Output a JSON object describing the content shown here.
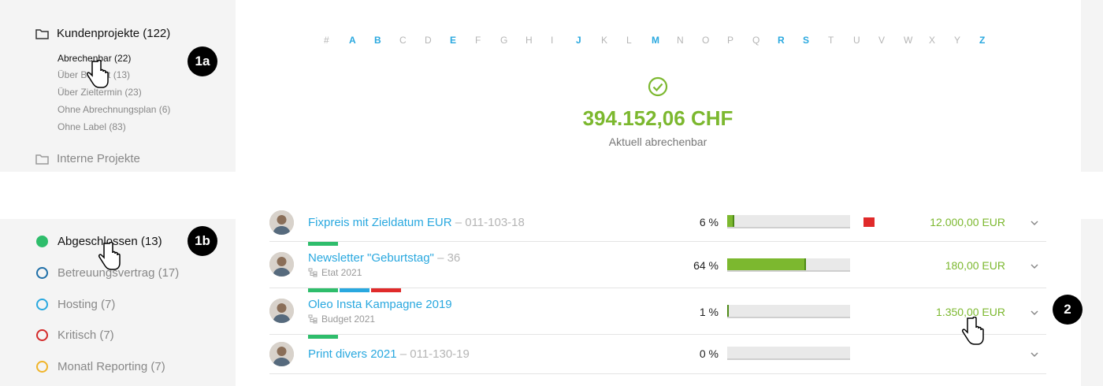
{
  "sidebar_top": {
    "main_folder": "Kundenprojekte (122)",
    "sub_items": [
      "Abrechenbar (22)",
      "Über Budget (13)",
      "Über Zieltermin (23)",
      "Ohne Abrechnungsplan (6)",
      "Ohne Label (83)"
    ],
    "internal_folder": "Interne Projekte",
    "badge": "1a"
  },
  "alphabet": {
    "letters": [
      "#",
      "A",
      "B",
      "C",
      "D",
      "E",
      "F",
      "G",
      "H",
      "I",
      "J",
      "K",
      "L",
      "M",
      "N",
      "O",
      "P",
      "Q",
      "R",
      "S",
      "T",
      "U",
      "V",
      "W",
      "X",
      "Y",
      "Z"
    ],
    "active": [
      "A",
      "B",
      "E",
      "J",
      "M",
      "R",
      "S",
      "Z"
    ]
  },
  "summary": {
    "amount": "394.152,06 CHF",
    "label": "Aktuell abrechenbar",
    "accent": "#7cb82f"
  },
  "status_filters": {
    "badge": "1b",
    "items": [
      {
        "label": "Abgeschlossen (13)",
        "color": "#2ebd6b",
        "filled": true
      },
      {
        "label": "Betreuungsvertrag (17)",
        "color": "#1f6fa8",
        "filled": false
      },
      {
        "label": "Hosting (7)",
        "color": "#29a8df",
        "filled": false
      },
      {
        "label": "Kritisch (7)",
        "color": "#d42a2a",
        "filled": false
      },
      {
        "label": "Monatl Reporting (7)",
        "color": "#f0b429",
        "filled": false
      }
    ]
  },
  "projects": [
    {
      "title": "Fixpreis mit Zieldatum EUR",
      "code": "– 011-103-18",
      "percent": "6 %",
      "progress": 0.06,
      "amount": "12.000,00 EUR",
      "sub": ""
    },
    {
      "title": "Newsletter \"Geburtstag\"",
      "code": "– 36",
      "percent": "64 %",
      "progress": 0.64,
      "amount": "180,00 EUR",
      "sub": "Etat 2021"
    },
    {
      "title": "Oleo Insta Kampagne 2019",
      "code": "",
      "percent": "1 %",
      "progress": 0.01,
      "amount": "1.350,00 EUR",
      "sub": "Budget 2021"
    },
    {
      "title": "Print divers 2021",
      "code": "– 011-130-19",
      "percent": "0 %",
      "progress": 0.0,
      "amount": "",
      "sub": ""
    }
  ],
  "row_badge": "2",
  "icons": [
    "folder-icon",
    "check-circle-icon",
    "chevron-down-icon",
    "hierarchy-icon",
    "hand-cursor-icon"
  ]
}
